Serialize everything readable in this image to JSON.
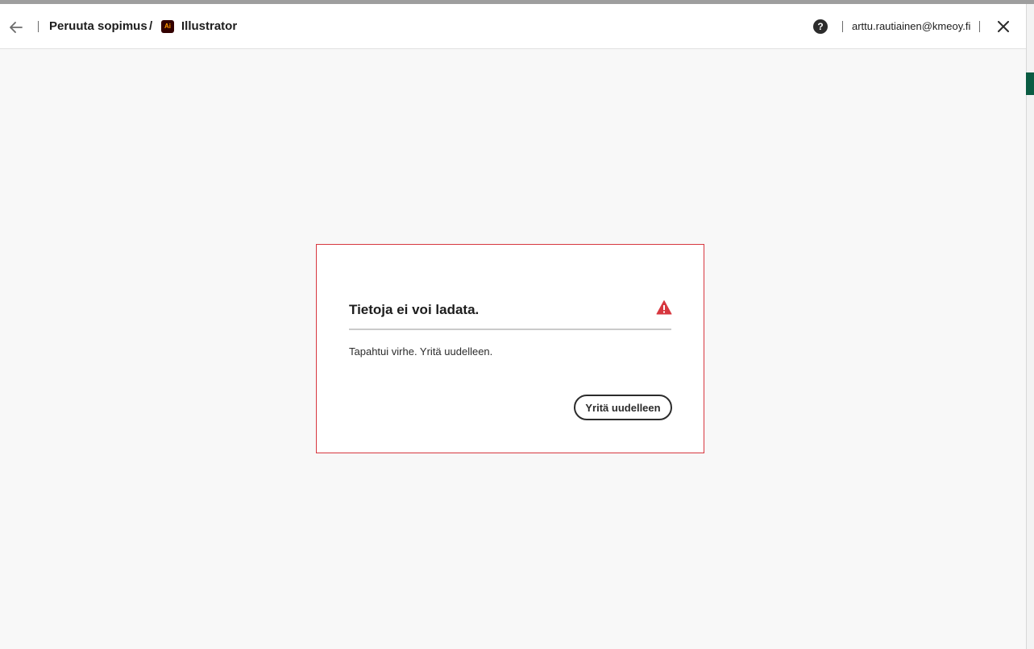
{
  "header": {
    "back_icon": "arrow-left-icon",
    "breadcrumb": {
      "first": "Peruuta sopimus",
      "separator": "/",
      "app_icon_text": "Ai",
      "app_name": "Illustrator"
    },
    "help_icon": "?",
    "user_email": "arttu.rautiainen@kmeoy.fi",
    "close_icon": "close-icon"
  },
  "dialog": {
    "title": "Tietoja ei voi ladata.",
    "message": "Tapahtui virhe. Yritä uudelleen.",
    "retry_label": "Yritä uudelleen",
    "alert_icon": "alert-triangle-icon"
  },
  "colors": {
    "error_red": "#d7373f",
    "text_dark": "#2c2c2c",
    "background": "#f8f8f8",
    "app_icon_bg": "#330000",
    "app_icon_fg": "#ff9a00",
    "edge_green": "#0b5c43"
  }
}
